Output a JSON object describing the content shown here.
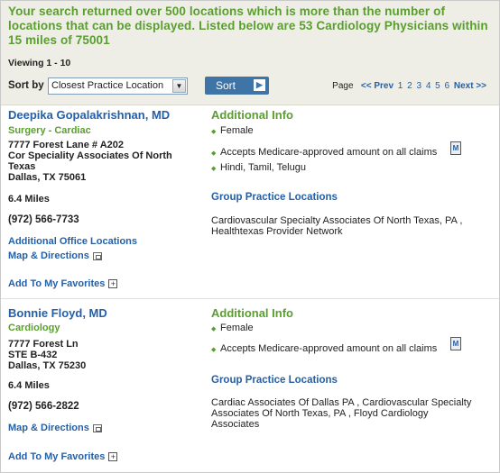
{
  "banner": "Your search returned over 500 locations which is more than the number of locations that can be displayed. Listed below are 53 Cardiology Physicians within 15 miles of 75001",
  "viewing": "Viewing 1 - 10",
  "sort": {
    "label": "Sort by",
    "selected": "Closest Practice Location",
    "button_label": "Sort",
    "go_glyph": "▶"
  },
  "pager": {
    "label": "Page",
    "prev": "<< Prev",
    "pages": [
      "1",
      "2",
      "3",
      "4",
      "5",
      "6"
    ],
    "next": "Next >>"
  },
  "labels": {
    "additional_info": "Additional Info",
    "group_practice": "Group Practice Locations",
    "add_favorites": "Add To My Favorites",
    "map_directions": "Map & Directions",
    "additional_office": "Additional Office Locations",
    "medicare_icon_text": "M"
  },
  "doctors": [
    {
      "name": "Deepika Gopalakrishnan, MD",
      "specialty": "Surgery - Cardiac",
      "address": [
        "7777 Forest Lane # A202",
        "Cor Speciality Associates Of North",
        "Texas",
        "Dallas, TX 75061"
      ],
      "distance": "6.4 Miles",
      "phone": "(972) 566-7733",
      "info": [
        "Female",
        "Accepts Medicare-approved amount on all claims",
        "Hindi, Tamil, Telugu"
      ],
      "group_practice": [
        "Cardiovascular Specialty Associates Of North Texas, PA ,",
        "Healthtexas Provider Network"
      ]
    },
    {
      "name": "Bonnie Floyd, MD",
      "specialty": "Cardiology",
      "address": [
        "7777 Forest Ln",
        "STE B-432",
        "Dallas, TX 75230"
      ],
      "distance": "6.4 Miles",
      "phone": "(972) 566-2822",
      "info": [
        "Female",
        "Accepts Medicare-approved amount on all claims"
      ],
      "group_practice": [
        "Cardiac Associates Of Dallas PA , Cardiovascular Specialty",
        "Associates Of North Texas, PA , Floyd Cardiology",
        "Associates"
      ]
    }
  ],
  "colors": {
    "accent_green": "#5a9e2f",
    "link_blue": "#2460a8",
    "button_blue": "#3f74a6",
    "header_bg": "#eeeee6"
  },
  "icons": {
    "plus": "plus-icon",
    "map": "map-icon",
    "medicare": "medicare-icon",
    "bullet": "bullet-diamond-icon"
  }
}
